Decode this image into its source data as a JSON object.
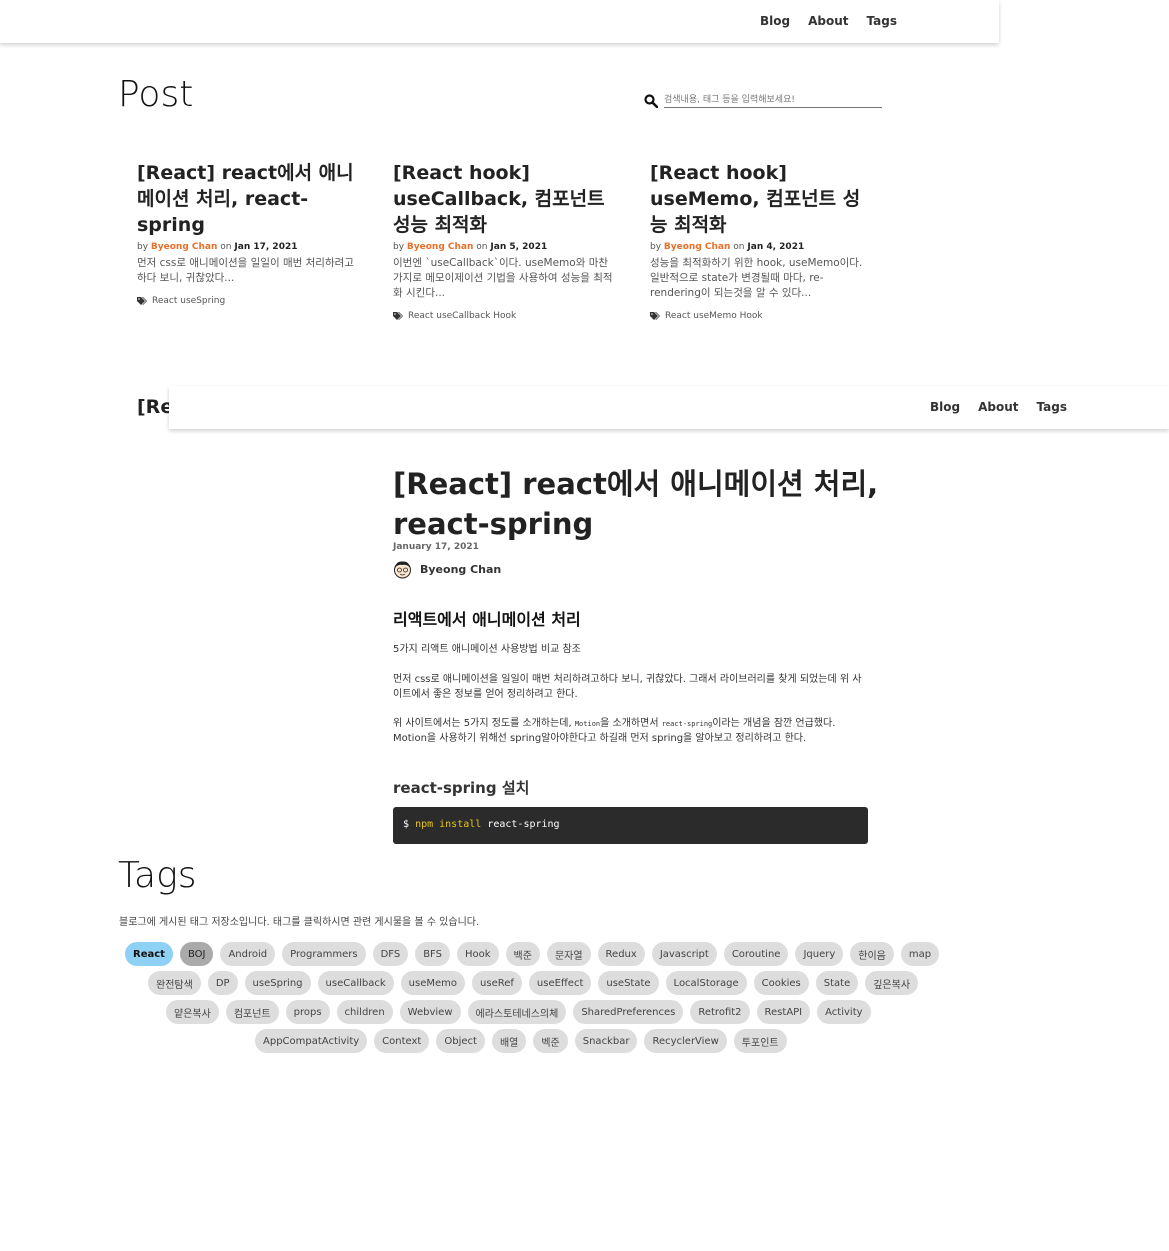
{
  "nav": {
    "links": [
      "Blog",
      "About",
      "Tags"
    ]
  },
  "post_list": {
    "title": "Post",
    "search": {
      "placeholder": "검색내용, 태그 등을 입력해보세요!",
      "icon": "search-icon"
    },
    "cards": [
      {
        "title": "[React] react에서 애니메이션 처리, react-spring",
        "by": "by",
        "author": "Byeong Chan",
        "on": "on",
        "date": "Jan 17, 2021",
        "excerpt": "먼저 css로 애니메이션을 일일이 매번 처리하려고하다 보니, 귀찮았다...",
        "tags": "React useSpring"
      },
      {
        "title": "[React hook] useCallback, 컴포넌트 성능 최적화",
        "by": "by",
        "author": "Byeong Chan",
        "on": "on",
        "date": "Jan 5, 2021",
        "excerpt": "이번엔 `useCallback`이다. useMemo와 마찬가지로 메모이제이션 기법을 사용하여 성능을 최적화 시킨다...",
        "tags": "React useCallback Hook"
      },
      {
        "title": "[React hook] useMemo, 컴포넌트 성능 최적화",
        "by": "by",
        "author": "Byeong Chan",
        "on": "on",
        "date": "Jan 4, 2021",
        "excerpt": "성능을 최적화하기 위한 hook, useMemo이다. 일반적으로 state가 변경될때 마다, re-rendering이 되는것을 알 수 있다...",
        "tags": "React useMemo Hook"
      },
      {
        "title": "[Re 데이 시 s"
      }
    ]
  },
  "article": {
    "title": "[React] react에서 애니메이션 처리, react-spring",
    "date": "January 17, 2021",
    "author": "Byeong Chan",
    "h2": "리액트에서 애니메이션 처리",
    "p1": "5가지 리액트 애니메이션 사용방법 비교 참조",
    "p2": "먼저 css로 애니메이션을 일일이 매번 처리하려고하다 보니, 귀찮았다. 그래서 라이브러리를 찾게 되었는데 위 사이트에서 좋은 정보를 얻어 정리하려고 한다.",
    "p3_a": "위 사이트에서는 5가지 정도를 소개하는데, ",
    "p3_code1": "Motion",
    "p3_b": "을 소개하면서 ",
    "p3_code2": "react-spring",
    "p3_c": "이라는 개념을 잠깐 언급했다. Motion을 사용하기 위해선 spring알아야한다고 하길래 먼저 spring을 알아보고 정리하려고 한다.",
    "h3": "react-spring 설치",
    "code": {
      "prompt": "$",
      "cmd": "npm install",
      "arg": "react-spring"
    }
  },
  "tags_page": {
    "title": "Tags",
    "description": "블로그에 게시된 태그 저장소입니다. 태그를 클릭하시면 관련 게시물을 볼 수 있습니다.",
    "rows": [
      [
        "React",
        "BOJ",
        "Android",
        "Programmers",
        "DFS",
        "BFS",
        "Hook",
        "백준",
        "문자열",
        "Redux",
        "Javascript",
        "Coroutine",
        "Jquery",
        "한이음",
        "map"
      ],
      [
        "완전탐색",
        "DP",
        "useSpring",
        "useCallback",
        "useMemo",
        "useRef",
        "useEffect",
        "useState",
        "LocalStorage",
        "Cookies",
        "State",
        "깊은복사"
      ],
      [
        "얕은복사",
        "컴포넌트",
        "props",
        "children",
        "Webview",
        "에라스토테네스의체",
        "SharedPreferences",
        "Retrofit2",
        "RestAPI",
        "Activity"
      ],
      [
        "AppCompatActivity",
        "Context",
        "Object",
        "배열",
        "벡준",
        "Snackbar",
        "RecyclerView",
        "투포인트"
      ]
    ],
    "active_tag": "React",
    "hover_tag": "BOJ"
  },
  "colors": {
    "author_accent": "#e8702a",
    "active_tag": "#8fd0f5",
    "tag_bg": "#dddddd",
    "code_bg": "#2b2b2b",
    "code_cmd": "#e6c619"
  }
}
